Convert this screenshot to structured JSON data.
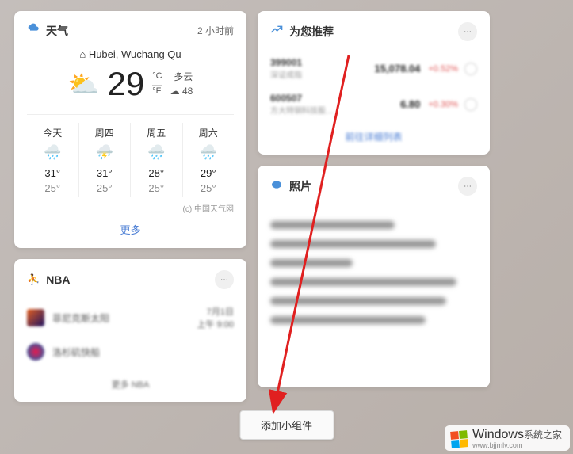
{
  "weather": {
    "title": "天气",
    "time_label": "2 小时前",
    "location_icon": "⌂",
    "location": "Hubei, Wuchang Qu",
    "current_temp": "29",
    "unit_c": "°C",
    "unit_f": "°F",
    "condition": "多云",
    "aqi_label": "☁ 48",
    "forecast": [
      {
        "day": "今天",
        "icon": "🌧️",
        "hi": "31°",
        "lo": "25°"
      },
      {
        "day": "周四",
        "icon": "⛈️",
        "hi": "31°",
        "lo": "25°"
      },
      {
        "day": "周五",
        "icon": "🌧️",
        "hi": "28°",
        "lo": "25°"
      },
      {
        "day": "周六",
        "icon": "🌧️",
        "hi": "29°",
        "lo": "25°"
      }
    ],
    "attribution": "(c) 中国天气网",
    "more_label": "更多"
  },
  "nba": {
    "title": "NBA",
    "games": [
      {
        "team": "菲尼克斯太阳",
        "date": "7月1日",
        "time": "上午 9:00"
      },
      {
        "team": "洛杉矶快船",
        "date": "",
        "time": ""
      }
    ],
    "more_label": "更多 NBA"
  },
  "stocks": {
    "title": "为您推荐",
    "rows": [
      {
        "code": "399001",
        "name": "深证成指",
        "price": "15,078.04",
        "change": "+0.52%"
      },
      {
        "code": "600507",
        "name": "方大特钢科技股…",
        "price": "6.80",
        "change": "+0.30%"
      }
    ],
    "more_label": "前往详细列表"
  },
  "photos": {
    "title": "照片"
  },
  "add_widget_label": "添加小组件",
  "watermark": {
    "main": "Windows",
    "sub1": "系统之家",
    "sub2": "www.bjjmlv.com"
  }
}
